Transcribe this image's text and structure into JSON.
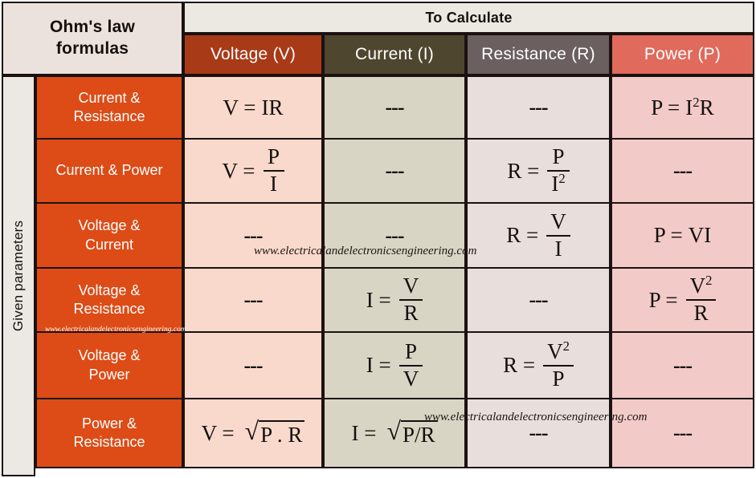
{
  "title": {
    "line1": "Ohm's law",
    "line2": "formulas"
  },
  "header": {
    "group_label": "To Calculate",
    "columns": [
      {
        "label": "Voltage (V)",
        "color": "#a83a18",
        "cell_color": "#f9d9cb"
      },
      {
        "label": "Current (I)",
        "color": "#4f4630",
        "cell_color": "#d9d5c5"
      },
      {
        "label": "Resistance (R)",
        "color": "#6b5f5f",
        "cell_color": "#e8dedc"
      },
      {
        "label": "Power (P)",
        "color": "#e06a5c",
        "cell_color": "#f2cbc8"
      }
    ]
  },
  "side_header": {
    "label": "Given parameters",
    "color": "#ece8e3"
  },
  "rows": [
    {
      "label_line1": "Current &",
      "label_line2": "Resistance",
      "voltage": {
        "lhs": "V =",
        "rhs": "IR"
      },
      "current": {
        "lhs": "",
        "rhs": "---"
      },
      "resistance": {
        "lhs": "",
        "rhs": "---"
      },
      "power": {
        "lhs": "P =",
        "rhs": "I²R"
      }
    },
    {
      "label_line1": "Current & Power",
      "label_line2": "",
      "voltage": {
        "lhs": "V =",
        "num": "P",
        "den": "I"
      },
      "current": {
        "lhs": "",
        "rhs": "---"
      },
      "resistance": {
        "lhs": "R =",
        "num": "P",
        "den": "I²"
      },
      "power": {
        "lhs": "",
        "rhs": "---"
      }
    },
    {
      "label_line1": "Voltage &",
      "label_line2": "Current",
      "voltage": {
        "lhs": "",
        "rhs": "---"
      },
      "current": {
        "lhs": "",
        "rhs": "---"
      },
      "resistance": {
        "lhs": "R =",
        "num": "V",
        "den": "I"
      },
      "power": {
        "lhs": "P =",
        "rhs": "VI"
      }
    },
    {
      "label_line1": "Voltage &",
      "label_line2": "Resistance",
      "voltage": {
        "lhs": "",
        "rhs": "---"
      },
      "current": {
        "lhs": "I =",
        "num": "V",
        "den": "R"
      },
      "resistance": {
        "lhs": "",
        "rhs": "---"
      },
      "power": {
        "lhs": "P =",
        "num": "V²",
        "den": "R"
      }
    },
    {
      "label_line1": "Voltage &",
      "label_line2": "Power",
      "voltage": {
        "lhs": "",
        "rhs": "---"
      },
      "current": {
        "lhs": "I =",
        "num": "P",
        "den": "V"
      },
      "resistance": {
        "lhs": "R =",
        "num": "V²",
        "den": "P"
      },
      "power": {
        "lhs": "",
        "rhs": "---"
      }
    },
    {
      "label_line1": "Power &",
      "label_line2": "Resistance",
      "voltage": {
        "lhs": "V =",
        "radicand": "P . R"
      },
      "current": {
        "lhs": "I =",
        "radicand": "P/R"
      },
      "resistance": {
        "lhs": "",
        "rhs": "---"
      },
      "power": {
        "lhs": "",
        "rhs": "---"
      }
    }
  ],
  "watermarks": {
    "row3": "www.electricalandelectronicsengineering.com",
    "row6": "www.electricalandelectronicsengineering.com",
    "row_label": "www.electricalandelectronicsengineering.com"
  },
  "symbols": {
    "radical_sign": "√",
    "dashes": "---"
  }
}
